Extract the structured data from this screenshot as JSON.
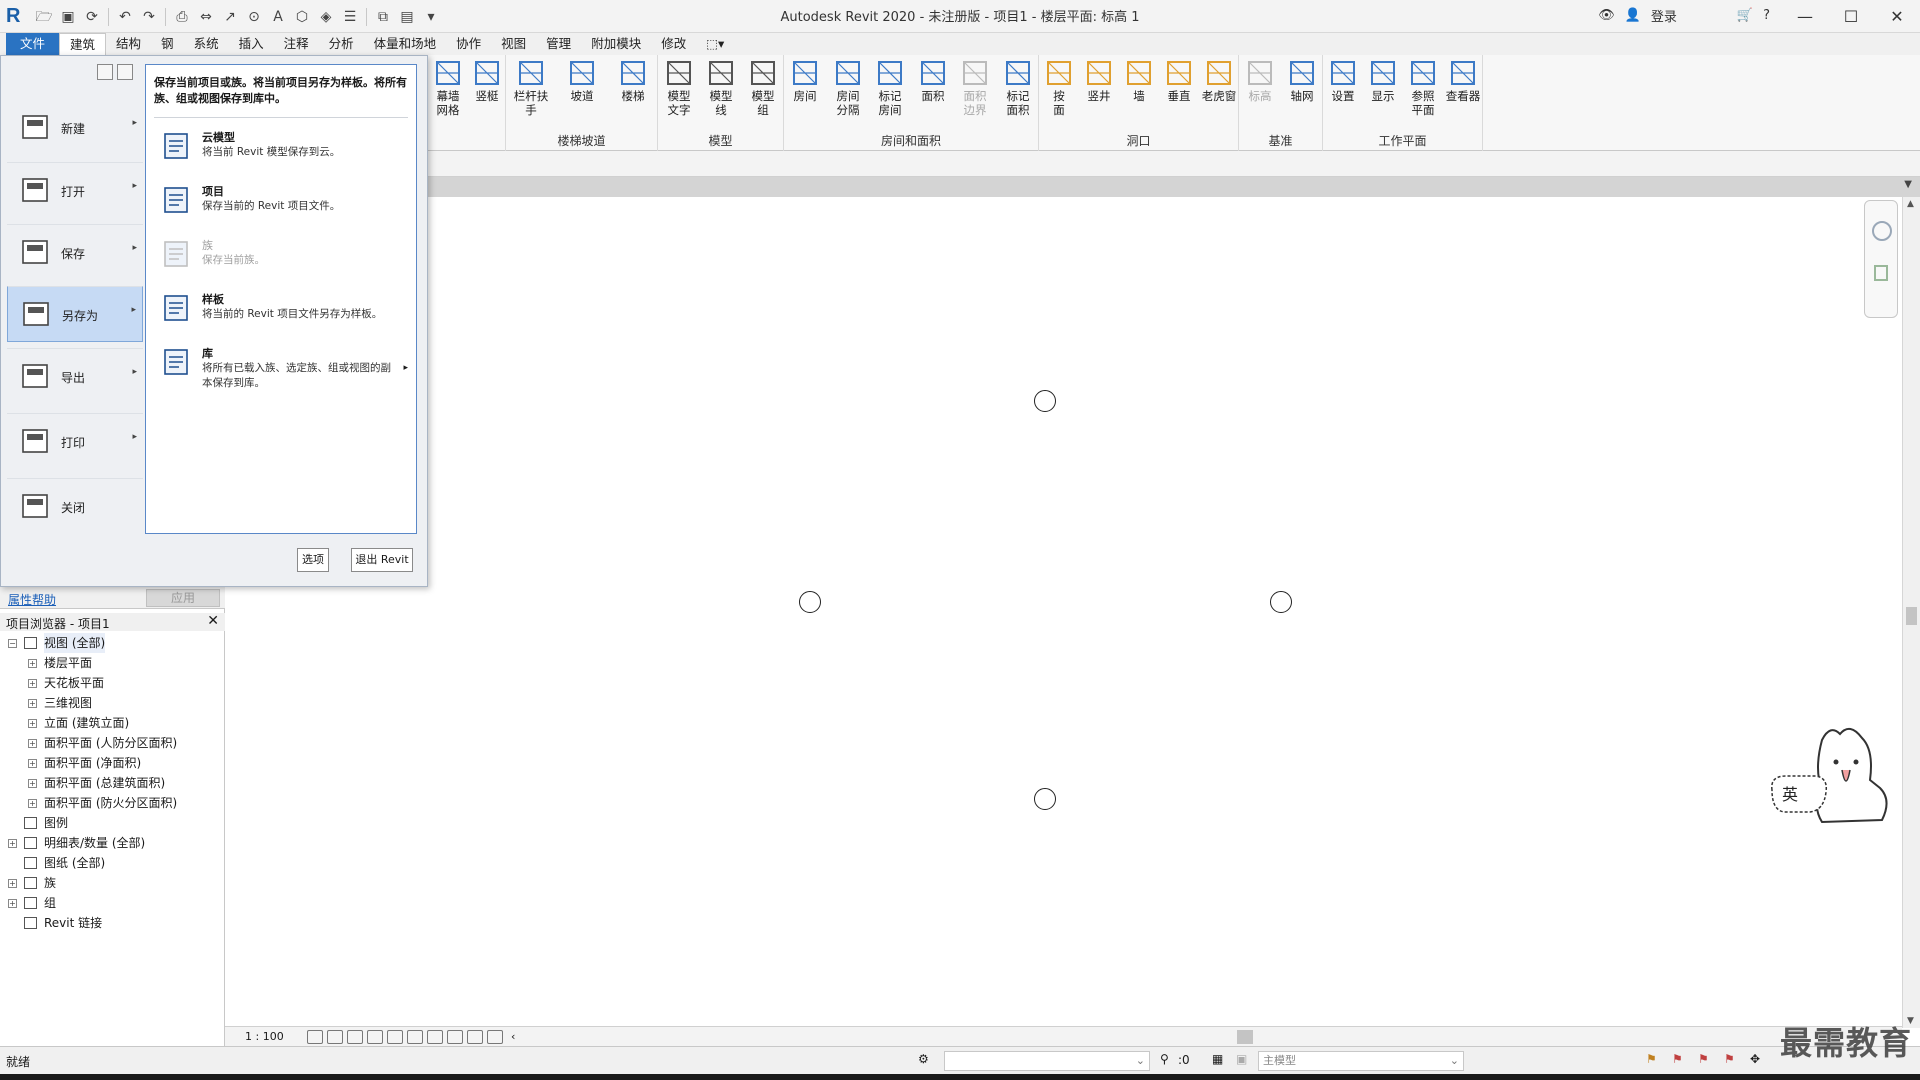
{
  "window": {
    "title": "Autodesk Revit 2020 - 未注册版 - 项目1 - 楼层平面: 标高 1",
    "login_label": "登录",
    "minimize": "—",
    "maximize": "☐",
    "close": "✕"
  },
  "ribbon_tabs": [
    "文件",
    "建筑",
    "结构",
    "钢",
    "系统",
    "插入",
    "注释",
    "分析",
    "体量和场地",
    "协作",
    "视图",
    "管理",
    "附加模块",
    "修改"
  ],
  "ribbon": {
    "groups": [
      {
        "label": "",
        "buttons": [
          {
            "label": "幕墙\n网格",
            "icon": "curtain-grid-icon"
          },
          {
            "label": "竖梃",
            "icon": "mullion-icon"
          }
        ]
      },
      {
        "label": "楼梯坡道",
        "buttons": [
          {
            "label": "栏杆扶手",
            "icon": "railing-icon"
          },
          {
            "label": "坡道",
            "icon": "ramp-icon"
          },
          {
            "label": "楼梯",
            "icon": "stair-icon"
          }
        ]
      },
      {
        "label": "模型",
        "buttons": [
          {
            "label": "模型\n文字",
            "icon": "model-text-icon"
          },
          {
            "label": "模型\n线",
            "icon": "model-line-icon"
          },
          {
            "label": "模型\n组",
            "icon": "model-group-icon"
          }
        ]
      },
      {
        "label": "房间和面积",
        "buttons": [
          {
            "label": "房间",
            "icon": "room-icon"
          },
          {
            "label": "房间\n分隔",
            "icon": "room-separator-icon"
          },
          {
            "label": "标记\n房间",
            "icon": "tag-room-icon"
          },
          {
            "label": "面积",
            "icon": "area-icon"
          },
          {
            "label": "面积\n边界",
            "icon": "area-boundary-icon",
            "disabled": true
          },
          {
            "label": "标记\n面积",
            "icon": "tag-area-icon"
          }
        ]
      },
      {
        "label": "洞口",
        "buttons": [
          {
            "label": "按\n面",
            "icon": "by-face-icon"
          },
          {
            "label": "竖井",
            "icon": "shaft-icon"
          },
          {
            "label": "墙",
            "icon": "wall-opening-icon"
          },
          {
            "label": "垂直",
            "icon": "vertical-opening-icon"
          },
          {
            "label": "老虎窗",
            "icon": "dormer-icon"
          }
        ]
      },
      {
        "label": "基准",
        "buttons": [
          {
            "label": "标高",
            "icon": "level-icon",
            "disabled": true
          },
          {
            "label": "轴网",
            "icon": "grid-icon"
          }
        ]
      },
      {
        "label": "工作平面",
        "buttons": [
          {
            "label": "设置",
            "icon": "set-workplane-icon"
          },
          {
            "label": "显示",
            "icon": "show-workplane-icon"
          },
          {
            "label": "参照\n平面",
            "icon": "reference-plane-icon"
          },
          {
            "label": "查看器",
            "icon": "viewer-icon"
          }
        ]
      }
    ]
  },
  "app_menu": {
    "commands": [
      {
        "label": "新建",
        "icon": "new-icon"
      },
      {
        "label": "打开",
        "icon": "open-folder-icon"
      },
      {
        "label": "保存",
        "icon": "save-icon"
      },
      {
        "label": "另存为",
        "icon": "save-as-icon",
        "hot": true
      },
      {
        "label": "导出",
        "icon": "export-icon"
      },
      {
        "label": "打印",
        "icon": "print-icon"
      },
      {
        "label": "关闭",
        "icon": "close-doc-icon"
      }
    ],
    "header": "保存当前项目或族。将当前项目另存为样板。将所有族、组或视图保存到库中。",
    "sub_items": [
      {
        "title": "云模型",
        "desc": "将当前 Revit 模型保存到云。",
        "icon": "cloud-model-icon"
      },
      {
        "title": "项目",
        "desc": "保存当前的 Revit 项目文件。",
        "icon": "project-icon"
      },
      {
        "title": "族",
        "desc": "保存当前族。",
        "icon": "family-icon",
        "disabled": true
      },
      {
        "title": "样板",
        "desc": "将当前的 Revit 项目文件另存为样板。",
        "icon": "template-icon"
      },
      {
        "title": "库",
        "desc": "将所有已载入族、选定族、组或视图的副本保存到库。",
        "icon": "library-icon",
        "has_submenu": true
      }
    ],
    "options_label": "选项",
    "exit_label": "退出 Revit"
  },
  "properties": {
    "help_link": "属性帮助",
    "apply_label": "应用"
  },
  "project_browser": {
    "title": "项目浏览器 - 项目1",
    "close": "✕",
    "nodes": [
      {
        "label": "视图 (全部)",
        "level": 0,
        "toggle": "−",
        "icon": "views-icon",
        "selected": true
      },
      {
        "label": "楼层平面",
        "level": 1,
        "toggle": "+"
      },
      {
        "label": "天花板平面",
        "level": 1,
        "toggle": "+"
      },
      {
        "label": "三维视图",
        "level": 1,
        "toggle": "+"
      },
      {
        "label": "立面 (建筑立面)",
        "level": 1,
        "toggle": "+"
      },
      {
        "label": "面积平面 (人防分区面积)",
        "level": 1,
        "toggle": "+"
      },
      {
        "label": "面积平面 (净面积)",
        "level": 1,
        "toggle": "+"
      },
      {
        "label": "面积平面 (总建筑面积)",
        "level": 1,
        "toggle": "+"
      },
      {
        "label": "面积平面 (防火分区面积)",
        "level": 1,
        "toggle": "+"
      },
      {
        "label": "图例",
        "level": 0,
        "toggle": "",
        "icon": "legend-icon"
      },
      {
        "label": "明细表/数量 (全部)",
        "level": 0,
        "toggle": "+",
        "icon": "schedule-icon"
      },
      {
        "label": "图纸 (全部)",
        "level": 0,
        "toggle": "",
        "icon": "sheet-icon"
      },
      {
        "label": "族",
        "level": 0,
        "toggle": "+",
        "icon": "family-tree-icon"
      },
      {
        "label": "组",
        "level": 0,
        "toggle": "+",
        "icon": "group-icon"
      },
      {
        "label": "Revit 链接",
        "level": 0,
        "toggle": "",
        "icon": "link-icon"
      }
    ]
  },
  "view_control": {
    "scale": "1 : 100"
  },
  "statusbar": {
    "status": "就绪",
    "zero": ":0",
    "model_field": "主模型"
  },
  "watermark": "最需教育",
  "mascot_text": "英"
}
